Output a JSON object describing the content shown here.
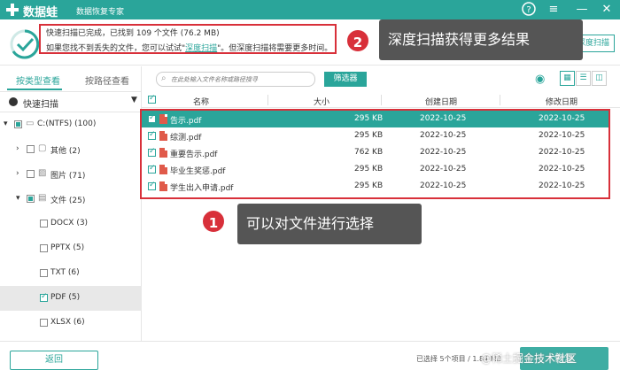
{
  "app": {
    "name": "数据蛙",
    "subtitle": "数据恢复专家"
  },
  "status": {
    "line1": "快速扫描已完成，已找到 109 个文件 (76.2 MB)",
    "line2_prefix": "如果您找不到丢失的文件，您可以试试\"",
    "line2_link": "深度扫描",
    "line2_suffix": "\"。但深度扫描将需要更多时间。",
    "deep_button": "深度扫描"
  },
  "callouts": {
    "one_num": "1",
    "one_text": "可以对文件进行选择",
    "two_num": "2",
    "two_text": "深度扫描获得更多结果"
  },
  "sidebar": {
    "tab_type": "按类型查看",
    "tab_path": "按路径查看",
    "scan_mode": "快速扫描",
    "tree": [
      {
        "label": "C:(NTFS) (100)"
      },
      {
        "label": "其他 (2)"
      },
      {
        "label": "图片 (71)"
      },
      {
        "label": "文件 (25)"
      },
      {
        "label": "DOCX (3)"
      },
      {
        "label": "PPTX (5)"
      },
      {
        "label": "TXT (6)"
      },
      {
        "label": "PDF (5)"
      },
      {
        "label": "XLSX (6)"
      }
    ]
  },
  "toolbar": {
    "search_placeholder": "在此处输入文件名称或路径搜寻",
    "filter_button": "筛选器"
  },
  "table": {
    "headers": {
      "name": "名称",
      "size": "大小",
      "created": "创建日期",
      "modified": "修改日期"
    },
    "rows": [
      {
        "name": "告示.pdf",
        "size": "295 KB",
        "created": "2022-10-25",
        "modified": "2022-10-25"
      },
      {
        "name": "综测.pdf",
        "size": "295 KB",
        "created": "2022-10-25",
        "modified": "2022-10-25"
      },
      {
        "name": "重要告示.pdf",
        "size": "762 KB",
        "created": "2022-10-25",
        "modified": "2022-10-25"
      },
      {
        "name": "毕业生奖惩.pdf",
        "size": "295 KB",
        "created": "2022-10-25",
        "modified": "2022-10-25"
      },
      {
        "name": "学生出入申请.pdf",
        "size": "295 KB",
        "created": "2022-10-25",
        "modified": "2022-10-25"
      }
    ]
  },
  "footer": {
    "back_button": "返回",
    "selection_info": "已选择 5个项目 / 1.84 MB",
    "watermark": "@稀土掘金技术社区",
    "recover_button": "恢复"
  },
  "colors": {
    "accent": "#2aa59a",
    "highlight": "#d8303a",
    "callout_bg": "#555555"
  }
}
